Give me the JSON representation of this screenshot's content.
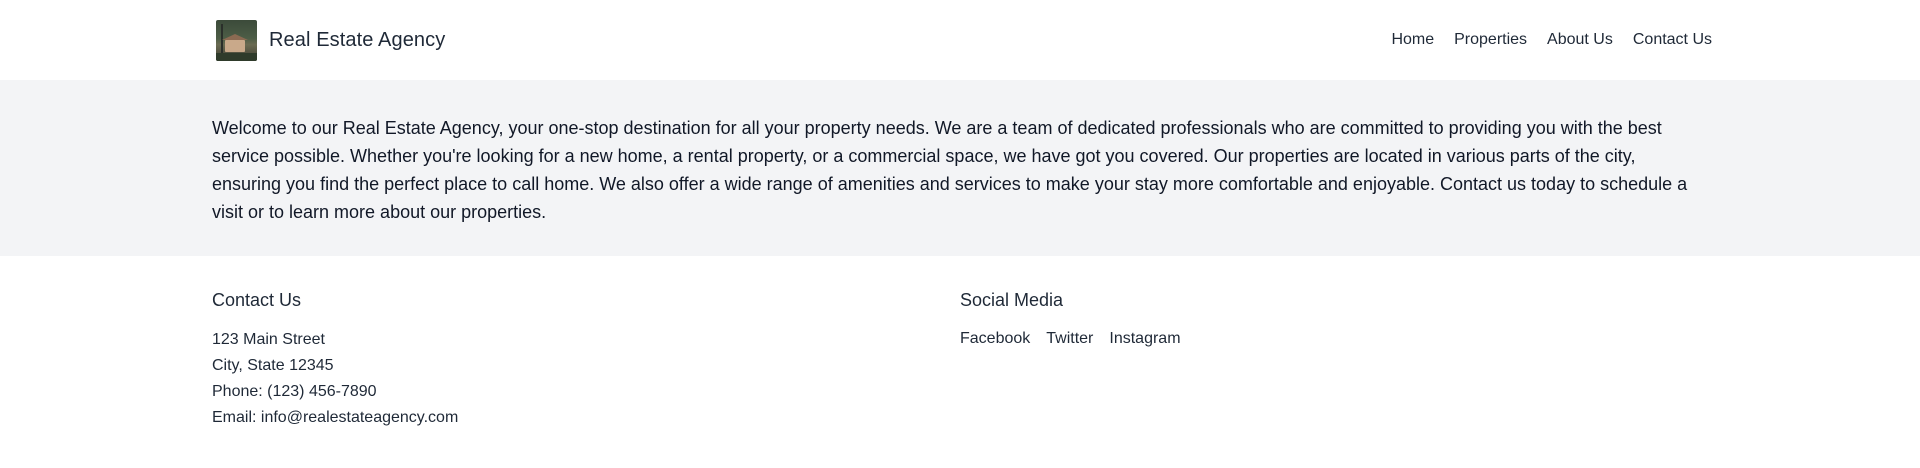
{
  "header": {
    "brand": "Real Estate Agency",
    "logo_icon": "house-photo-icon",
    "nav": [
      {
        "label": "Home"
      },
      {
        "label": "Properties"
      },
      {
        "label": "About Us"
      },
      {
        "label": "Contact Us"
      }
    ]
  },
  "intro": {
    "text": "Welcome to our Real Estate Agency, your one-stop destination for all your property needs. We are a team of dedicated professionals who are committed to providing you with the best service possible. Whether you're looking for a new home, a rental property, or a commercial space, we have got you covered. Our properties are located in various parts of the city, ensuring you find the perfect place to call home. We also offer a wide range of amenities and services to make your stay more comfortable and enjoyable. Contact us today to schedule a visit or to learn more about our properties."
  },
  "footer": {
    "contact": {
      "heading": "Contact Us",
      "street": "123 Main Street",
      "city": "City, State 12345",
      "phone": "Phone: (123) 456-7890",
      "email": "Email: info@realestateagency.com"
    },
    "social": {
      "heading": "Social Media",
      "links": [
        {
          "label": "Facebook"
        },
        {
          "label": "Twitter"
        },
        {
          "label": "Instagram"
        }
      ]
    }
  },
  "colors": {
    "intro_background": "#f3f4f6",
    "text": "#1f2937"
  }
}
